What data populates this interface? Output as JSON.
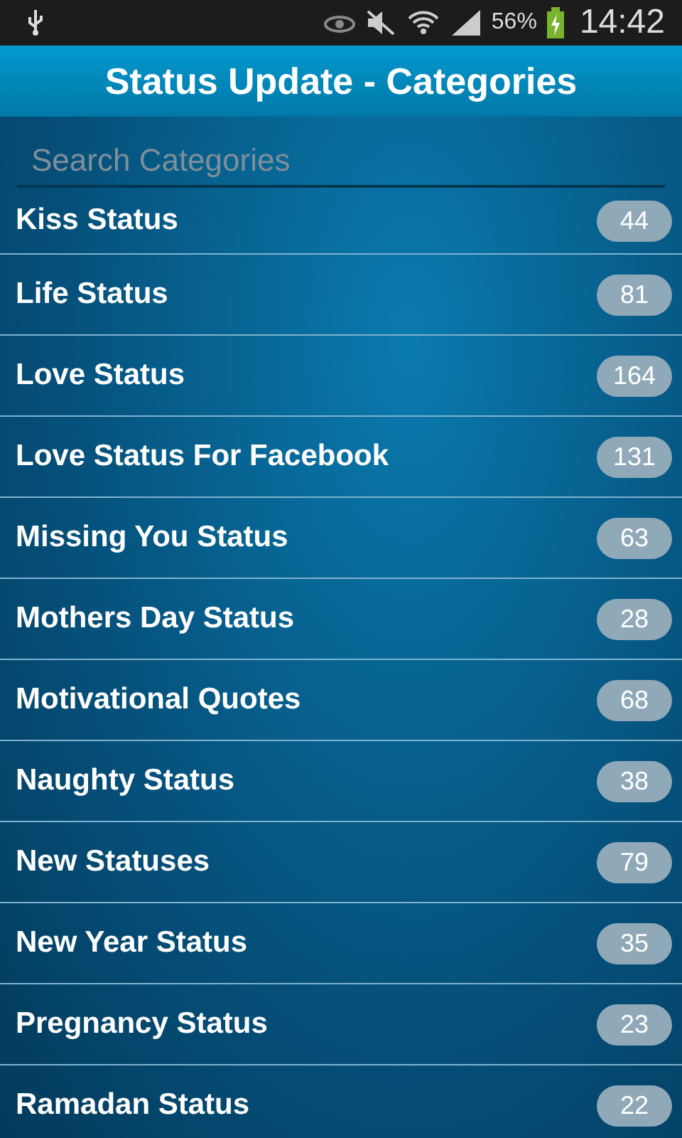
{
  "status_bar": {
    "battery": "56%",
    "time": "14:42"
  },
  "header": {
    "title": "Status Update - Categories"
  },
  "search": {
    "placeholder": "Search Categories"
  },
  "categories": [
    {
      "name": "Kiss Status",
      "count": "44"
    },
    {
      "name": "Life Status",
      "count": "81"
    },
    {
      "name": "Love Status",
      "count": "164"
    },
    {
      "name": "Love Status For Facebook",
      "count": "131"
    },
    {
      "name": "Missing You Status",
      "count": "63"
    },
    {
      "name": "Mothers Day Status",
      "count": "28"
    },
    {
      "name": "Motivational Quotes",
      "count": "68"
    },
    {
      "name": "Naughty Status",
      "count": "38"
    },
    {
      "name": "New Statuses",
      "count": "79"
    },
    {
      "name": "New Year Status",
      "count": "35"
    },
    {
      "name": "Pregnancy Status",
      "count": "23"
    },
    {
      "name": "Ramadan Status",
      "count": "22"
    }
  ]
}
